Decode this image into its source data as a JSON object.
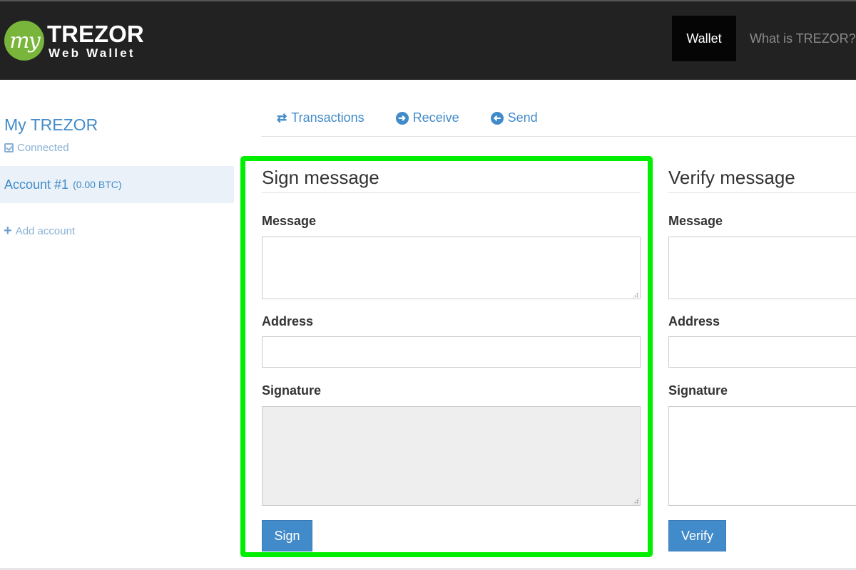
{
  "header": {
    "logo": {
      "badge": "my",
      "title": "TREZOR",
      "subtitle": "Web Wallet"
    },
    "nav": [
      {
        "label": "Wallet",
        "active": true
      },
      {
        "label": "What is TREZOR?",
        "active": false
      }
    ]
  },
  "sidebar": {
    "device_name": "My TREZOR",
    "status": "Connected",
    "accounts": [
      {
        "label": "Account #1",
        "balance": "(0.00 BTC)",
        "selected": true
      }
    ],
    "add_account": "Add account"
  },
  "subnav": [
    {
      "label": "Transactions",
      "icon": "swap-arrows-icon"
    },
    {
      "label": "Receive",
      "icon": "arrow-circle-right-icon"
    },
    {
      "label": "Send",
      "icon": "arrow-circle-left-icon"
    }
  ],
  "sign_panel": {
    "title": "Sign message",
    "message_label": "Message",
    "message_value": "",
    "address_label": "Address",
    "address_value": "",
    "signature_label": "Signature",
    "signature_value": "",
    "button_label": "Sign"
  },
  "verify_panel": {
    "title": "Verify message",
    "message_label": "Message",
    "message_value": "",
    "address_label": "Address",
    "address_value": "",
    "signature_label": "Signature",
    "signature_value": "",
    "button_label": "Verify"
  },
  "colors": {
    "accent": "#428bca",
    "header_bg": "#222222",
    "highlight": "#00ee00",
    "logo_green": "#78b53a"
  }
}
